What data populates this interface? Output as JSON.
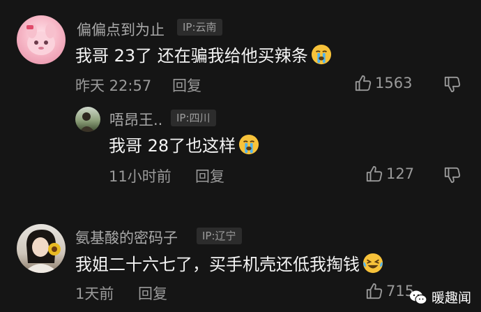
{
  "comments": [
    {
      "username": "偏偏点到为止",
      "ip": "IP:云南",
      "text": "我哥 23了 还在骗我给他买辣条",
      "time": "昨天 22:57",
      "reply_label": "回复",
      "likes": "1563"
    },
    {
      "username": "唔昂王..",
      "ip": "IP:四川",
      "text": "我哥 28了也这样",
      "time": "11小时前",
      "reply_label": "回复",
      "likes": "127"
    },
    {
      "username": "氨基酸的密码子",
      "ip": "IP:辽宁",
      "text": "我姐二十六七了，买手机壳还低我掏钱",
      "time": "1天前",
      "reply_label": "回复",
      "likes": "715"
    }
  ],
  "watermark": {
    "text": "暖趣闻"
  },
  "icons": {
    "like": "thumbs-up-icon",
    "dislike": "thumbs-down-icon",
    "crying": "crying-emoji-icon",
    "laughing": "laughing-tears-emoji-icon"
  }
}
